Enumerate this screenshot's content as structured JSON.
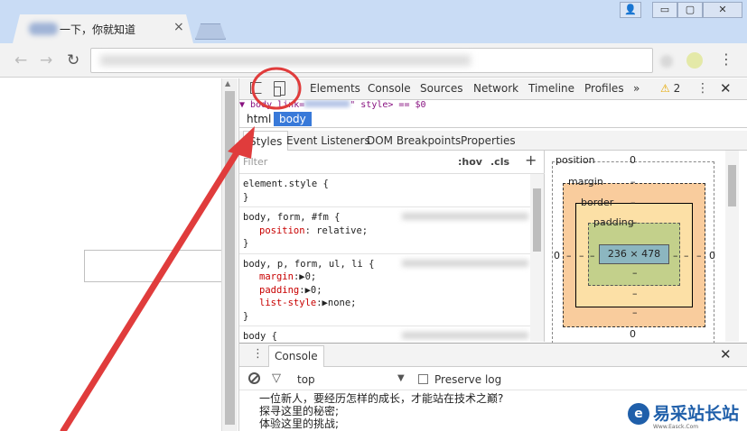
{
  "browser": {
    "tab_title": "一下，你就知道",
    "tab_close": "×",
    "window_buttons": {
      "user": "👤",
      "minimize": "▭",
      "maximize": "▢",
      "close": "✕"
    },
    "menu": "⋮"
  },
  "devtools": {
    "tabs": [
      "Elements",
      "Console",
      "Sources",
      "Network",
      "Timeline",
      "Profiles"
    ],
    "more_tabs": "»",
    "warning_count": "2",
    "elements_line_pre": "▼ body link=",
    "elements_line_post": "\" style> == $0",
    "breadcrumb": [
      "html",
      "body"
    ],
    "subtabs": [
      "Styles",
      "Event Listeners",
      "DOM Breakpoints",
      "Properties"
    ],
    "filter_placeholder": "Filter",
    "hov_label": ":hov",
    "cls_label": ".cls",
    "add_rule": "+",
    "rules": [
      {
        "selector": "element.style {",
        "props": [],
        "close": "}"
      },
      {
        "selector": "body, form, #fm {",
        "props": [
          {
            "name": "position",
            "value": "relative;"
          }
        ],
        "close": "}"
      },
      {
        "selector": "body, p, form, ul, li {",
        "props": [
          {
            "name": "margin",
            "value": "▶0;"
          },
          {
            "name": "padding",
            "value": "▶0;"
          },
          {
            "name": "list-style",
            "value": "▶none;"
          }
        ],
        "close": "}"
      },
      {
        "selector": "body {",
        "props": [],
        "close": ""
      }
    ],
    "box_model": {
      "position_label": "position",
      "position_value": "0",
      "margin_label": "margin",
      "margin_value": "–",
      "border_label": "border",
      "border_value": "–",
      "padding_label": "padding",
      "padding_value": "–",
      "content": "236 × 478",
      "side_value": "0",
      "dash": "–"
    },
    "console": {
      "tab_label": "Console",
      "context": "top",
      "preserve_log": "Preserve log",
      "output": [
        "一位新人，要经历怎样的成长，才能站在技术之巅?",
        "探寻这里的秘密;",
        "体验这里的挑战;"
      ]
    }
  },
  "watermark": {
    "logo_letter": "e",
    "title": "易采站长站",
    "subtitle": "Www.Easck.Com"
  },
  "colors": {
    "annotation_red": "#e03c3c",
    "selected_crumb": "#3879d9"
  }
}
